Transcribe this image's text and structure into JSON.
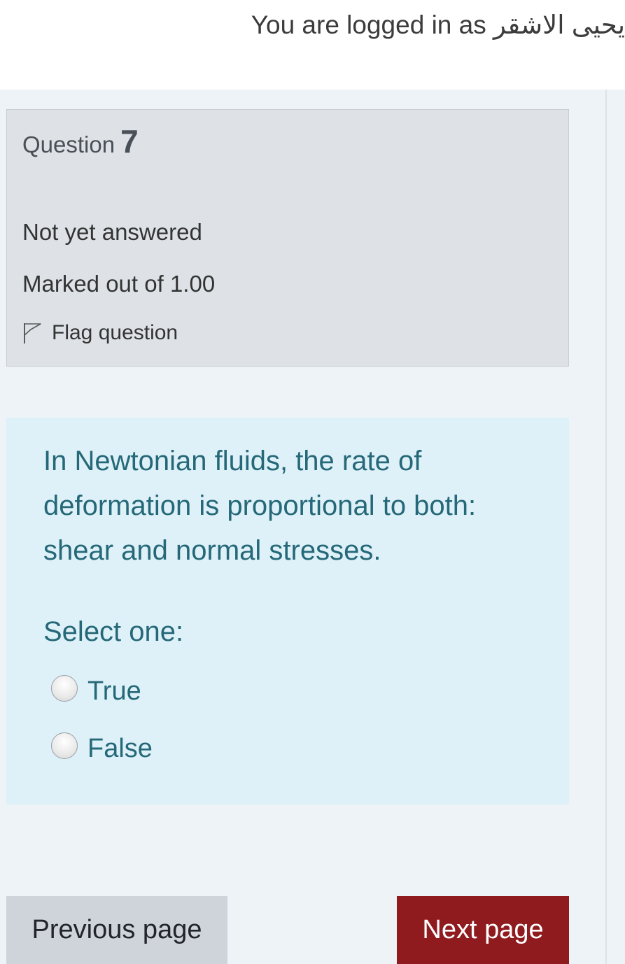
{
  "header": {
    "login_prefix": "You are logged in as",
    "user_name": "يحيى الاشقر"
  },
  "question_info": {
    "label": "Question",
    "number": "7",
    "state": "Not yet answered",
    "grade": "Marked out of 1.00",
    "flag_label": "Flag question",
    "flag_icon": "flag-outline-icon"
  },
  "question": {
    "text": "In Newtonian fluids, the rate of deformation is proportional to both: shear and normal stresses.",
    "prompt": "Select one:",
    "options": [
      {
        "label": "True"
      },
      {
        "label": "False"
      }
    ]
  },
  "navigation": {
    "previous_label": "Previous page",
    "next_label": "Next page"
  },
  "colors": {
    "info_bg": "#dee2e6",
    "content_bg": "#def1f8",
    "text_accent": "#256878",
    "next_button": "#8f1b1f",
    "prev_button": "#ced4da"
  }
}
